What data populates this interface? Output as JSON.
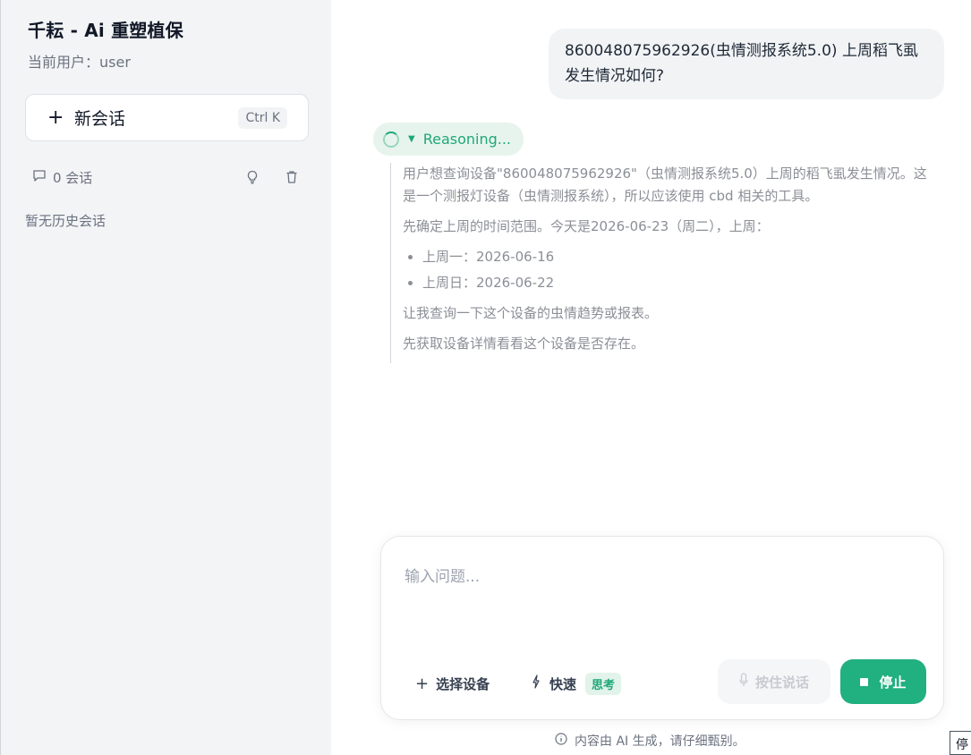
{
  "sidebar": {
    "app_title": "千耘 - Ai 重塑植保",
    "current_user": "当前用户：user",
    "new_chat": {
      "label": "新会话",
      "shortcut": "Ctrl K",
      "icon": "plus-icon"
    },
    "session_count": "0 会话",
    "icons": {
      "chat": "chat-bubble-icon",
      "tip": "lightbulb-icon",
      "delete": "trash-icon"
    },
    "empty_history": "暂无历史会话"
  },
  "conversation": {
    "user_message": "860048075962926(虫情测报系统5.0) 上周稻飞虱发生情况如何?",
    "reasoning": {
      "label": "Reasoning...",
      "paragraph_1": "用户想查询设备\"860048075962926\"（虫情测报系统5.0）上周的稻飞虱发生情况。这是一个测报灯设备（虫情测报系统），所以应该使用 cbd 相关的工具。",
      "paragraph_2": "先确定上周的时间范围。今天是2026-06-23（周二），上周：",
      "list": [
        "上周一：2026-06-16",
        "上周日：2026-06-22"
      ],
      "paragraph_3": "让我查询一下这个设备的虫情趋势或报表。",
      "paragraph_4": "先获取设备详情看看这个设备是否存在。"
    }
  },
  "composer": {
    "placeholder": "输入问题...",
    "select_device": "选择设备",
    "fast": "快速",
    "think_badge": "思考",
    "voice": "按住说话",
    "stop": "停止",
    "accent_color": "#21b07f"
  },
  "disclaimer": "内容由 AI 生成，请仔细甄别。",
  "corner_tab": "停"
}
